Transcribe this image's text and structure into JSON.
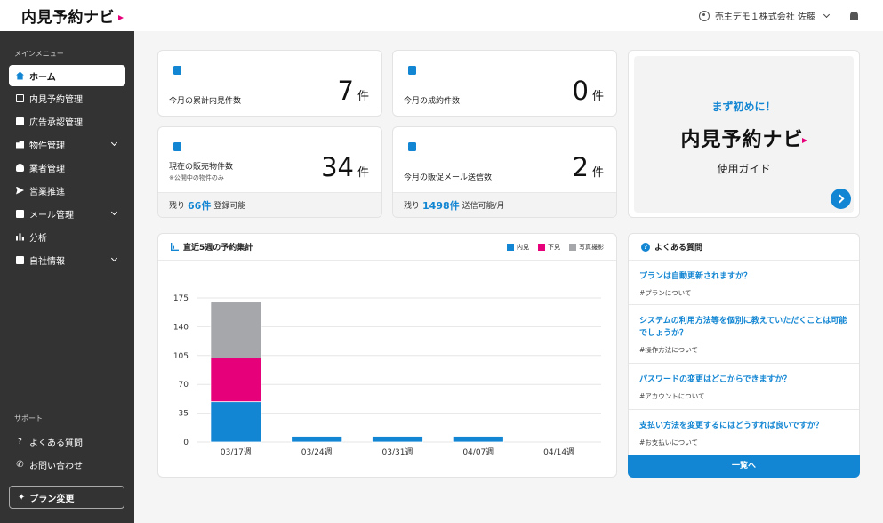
{
  "header": {
    "logo_text": "内見予約ナビ",
    "user_name": "売主デモ１株式会社 佐藤"
  },
  "sidebar": {
    "section_label": "メインメニュー",
    "items": [
      {
        "label": "ホーム",
        "icon": "home-icon"
      },
      {
        "label": "内見予約管理",
        "icon": "calendar-icon"
      },
      {
        "label": "広告承認管理",
        "icon": "document-icon"
      },
      {
        "label": "物件管理",
        "icon": "building-icon"
      },
      {
        "label": "業者管理",
        "icon": "person-icon"
      },
      {
        "label": "営業推進",
        "icon": "send-icon"
      },
      {
        "label": "メール管理",
        "icon": "mail-icon"
      },
      {
        "label": "分析",
        "icon": "bar-chart-icon"
      },
      {
        "label": "自社情報",
        "icon": "briefcase-icon"
      }
    ],
    "support_label": "サポート",
    "support_items": [
      {
        "label": "よくある質問",
        "icon": "question-icon"
      },
      {
        "label": "お問い合わせ",
        "icon": "phone-icon"
      }
    ],
    "plan_button": "プラン変更"
  },
  "stats": [
    {
      "label": "今月の累計内見件数",
      "value": "7",
      "unit": "件"
    },
    {
      "label": "今月の成約件数",
      "value": "0",
      "unit": "件"
    },
    {
      "label": "現在の販売物件数",
      "sub": "※公開中の物件のみ",
      "value": "34",
      "unit": "件",
      "foot_prefix": "残り",
      "foot_value": "66件",
      "foot_suffix": "登録可能"
    },
    {
      "label": "今月の販促メール送信数",
      "value": "2",
      "unit": "件",
      "foot_prefix": "残り",
      "foot_value": "1498件",
      "foot_suffix": "送信可能/月"
    }
  ],
  "guide": {
    "heading": "まず初めに！",
    "logo_text": "内見予約ナビ",
    "subtitle": "使用ガイド"
  },
  "chart_panel": {
    "title": "直近5週の予約集計"
  },
  "chart_data": {
    "type": "bar",
    "stacked": true,
    "categories": [
      "03/17週",
      "03/24週",
      "03/31週",
      "04/07週",
      "04/14週"
    ],
    "series": [
      {
        "name": "内見",
        "color": "#1386d3",
        "values": [
          49,
          7,
          7,
          7,
          0
        ]
      },
      {
        "name": "下見",
        "color": "#e6007a",
        "values": [
          53,
          0,
          0,
          0,
          0
        ]
      },
      {
        "name": "写真撮影",
        "color": "#a5a7aa",
        "values": [
          68,
          0,
          0,
          0,
          0
        ]
      }
    ],
    "yticks": [
      0,
      35,
      70,
      105,
      140,
      175
    ],
    "ylim": [
      0,
      175
    ],
    "grid": true,
    "legend": "top-right"
  },
  "faq": {
    "title": "よくある質問",
    "items": [
      {
        "q": "プランは自動更新されますか？",
        "tag": "#プランについて"
      },
      {
        "q": "システムの利用方法等を個別に教えていただくことは可能でしょうか？",
        "tag": "#操作方法について"
      },
      {
        "q": "パスワードの変更はどこからできますか？",
        "tag": "#アカウントについて"
      },
      {
        "q": "支払い方法を変更するにはどうすれば良いですか？",
        "tag": "#お支払いについて"
      }
    ],
    "more_label": "一覧へ"
  },
  "colors": {
    "accent": "#1386d3",
    "brand_pink": "#e6007a",
    "sidebar_bg": "#333333"
  }
}
